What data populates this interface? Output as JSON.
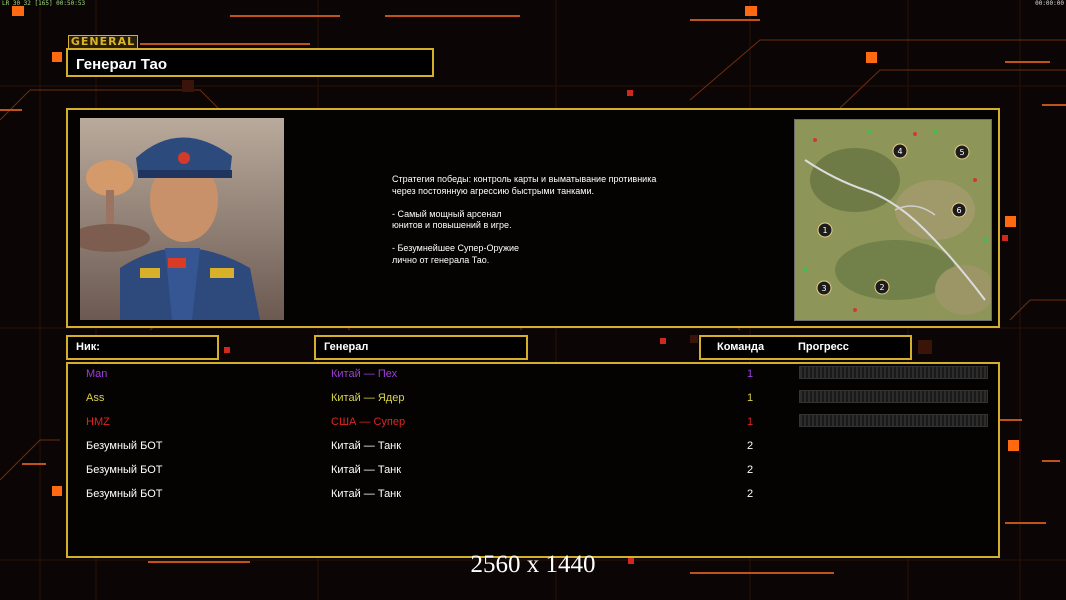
{
  "debug": {
    "left": "LR 30 32 [165] 00:50:53",
    "right": "00:00:00"
  },
  "general": {
    "tag": "GENERAL",
    "name": "Генерал Тао",
    "description": "Стратегия победы: контроль карты и выматывание противника\n через постоянную агрессию быстрыми танками.\n\n- Самый мощный арсенал\nюнитов и повышений в игре.\n\n- Безумнейшее Супер-Оружие\nлично от генерала Тао.",
    "portrait": "general-tao-portrait",
    "minimap_slots": [
      "1",
      "2",
      "3",
      "4",
      "5",
      "6"
    ]
  },
  "headers": {
    "nick": "Ник:",
    "general": "Генерал",
    "team": "Команда",
    "progress": "Прогресс"
  },
  "players": [
    {
      "nick": "Man",
      "general": "Китай — Пех",
      "team": "1",
      "color": "#9a3fd6",
      "progress": 0
    },
    {
      "nick": "Ass",
      "general": "Китай — Ядер",
      "team": "1",
      "color": "#d8d44a",
      "progress": 0
    },
    {
      "nick": "HMZ",
      "general": "США — Супер",
      "team": "1",
      "color": "#e02323",
      "progress": 0
    },
    {
      "nick": "Безумный БОТ",
      "general": "Китай — Танк",
      "team": "2",
      "color": "#ffffff"
    },
    {
      "nick": "Безумный БОТ",
      "general": "Китай — Танк",
      "team": "2",
      "color": "#ffffff"
    },
    {
      "nick": "Безумный БОТ",
      "general": "Китай — Танк",
      "team": "2",
      "color": "#ffffff"
    }
  ],
  "resolution": "2560 x 1440",
  "colors": {
    "accent": "#d4b02a",
    "lines": "#7a2a10",
    "squares": "#ff6a10"
  }
}
